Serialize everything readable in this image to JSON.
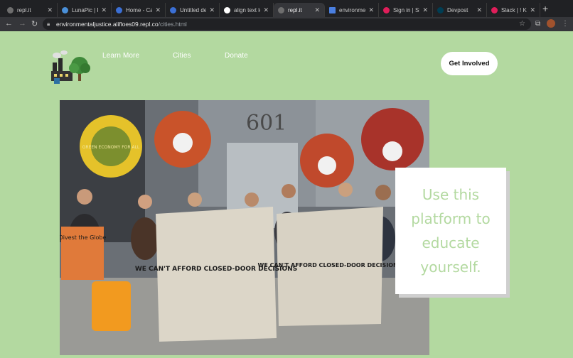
{
  "browser": {
    "tabs": [
      {
        "title": "repl.it",
        "favicon_color": "#6e6e6e"
      },
      {
        "title": "LunaPic | Fr",
        "favicon_color": "#4a90d9"
      },
      {
        "title": "Home - Can",
        "favicon_color": "#3b6fd4"
      },
      {
        "title": "Untitled des",
        "favicon_color": "#3b6fd4"
      },
      {
        "title": "align text lef",
        "favicon_color": "#ffffff"
      },
      {
        "title": "repl.it",
        "favicon_color": "#6e6e6e",
        "active": true
      },
      {
        "title": "environmen",
        "favicon_color": "#4a7fe0"
      },
      {
        "title": "Sign in | Sla",
        "favicon_color": "#e01e5a"
      },
      {
        "title": "Devpost",
        "favicon_color": "#003e54"
      },
      {
        "title": "Slack | ! Kim",
        "favicon_color": "#e01e5a"
      }
    ],
    "url_host": "environmentaljustice.alifloes09.repl.co",
    "url_path": "/cities.html"
  },
  "nav": {
    "links": [
      "Learn More",
      "Cities",
      "Donate"
    ],
    "cta_label": "Get Involved"
  },
  "hero": {
    "callout_text": "Use this platform to educate yourself.",
    "photo_banner_1": "WE CAN'T AFFORD CLOSED-DOOR DECISIONS",
    "photo_banner_2": "WE CAN'T AFFORD CLOSED-DOOR DECISIONS",
    "photo_sign_left": "Divest the Globe",
    "photo_sun_text": "GREEN ECONOMY FOR ALL",
    "photo_building_number": "601"
  },
  "colors": {
    "page_bg": "#b3d9a0",
    "callout_text": "#b3d9a0",
    "cta_bg": "#ffffff"
  }
}
